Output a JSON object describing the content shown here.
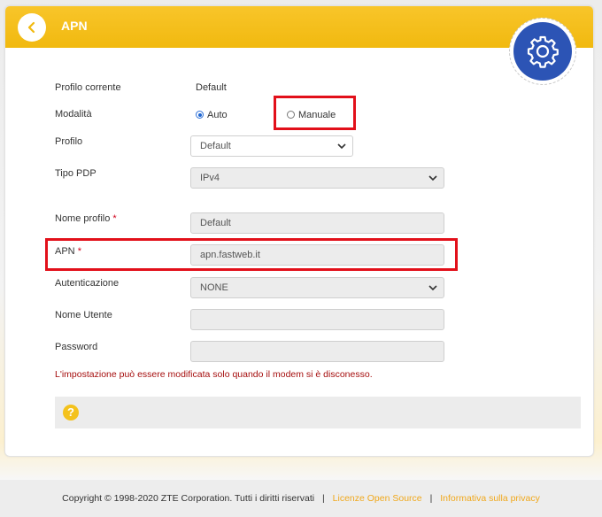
{
  "header": {
    "title": "APN",
    "back_icon": "chevron-left-icon",
    "settings_icon": "gear-icon",
    "accent_color": "#f5bf1c",
    "gear_color": "#2c54b5"
  },
  "form": {
    "current_profile_label": "Profilo corrente",
    "current_profile_value": "Default",
    "mode_label": "Modalità",
    "mode_auto": "Auto",
    "mode_manual": "Manuale",
    "mode_selected": "Auto",
    "profile_label": "Profilo",
    "profile_value": "Default",
    "pdp_label": "Tipo PDP",
    "pdp_value": "IPv4",
    "profile_name_label": "Nome profilo",
    "profile_name_value": "Default",
    "apn_label": "APN",
    "apn_value": "apn.fastweb.it",
    "auth_label": "Autenticazione",
    "auth_value": "NONE",
    "username_label": "Nome Utente",
    "username_value": "",
    "password_label": "Password",
    "password_value": "",
    "required_mark": "*",
    "warning": "L'impostazione può essere modificata solo quando il modem si è disconesso.",
    "warning_color": "#a50d0d"
  },
  "help": {
    "icon": "question-icon",
    "glyph": "?"
  },
  "footer": {
    "copyright": "Copyright © 1998-2020 ZTE Corporation. Tutti i diritti riservati",
    "separator": "|",
    "link_open_source": "Licenze Open Source",
    "link_privacy": "Informativa sulla privacy",
    "link_color": "#f0a81c"
  }
}
